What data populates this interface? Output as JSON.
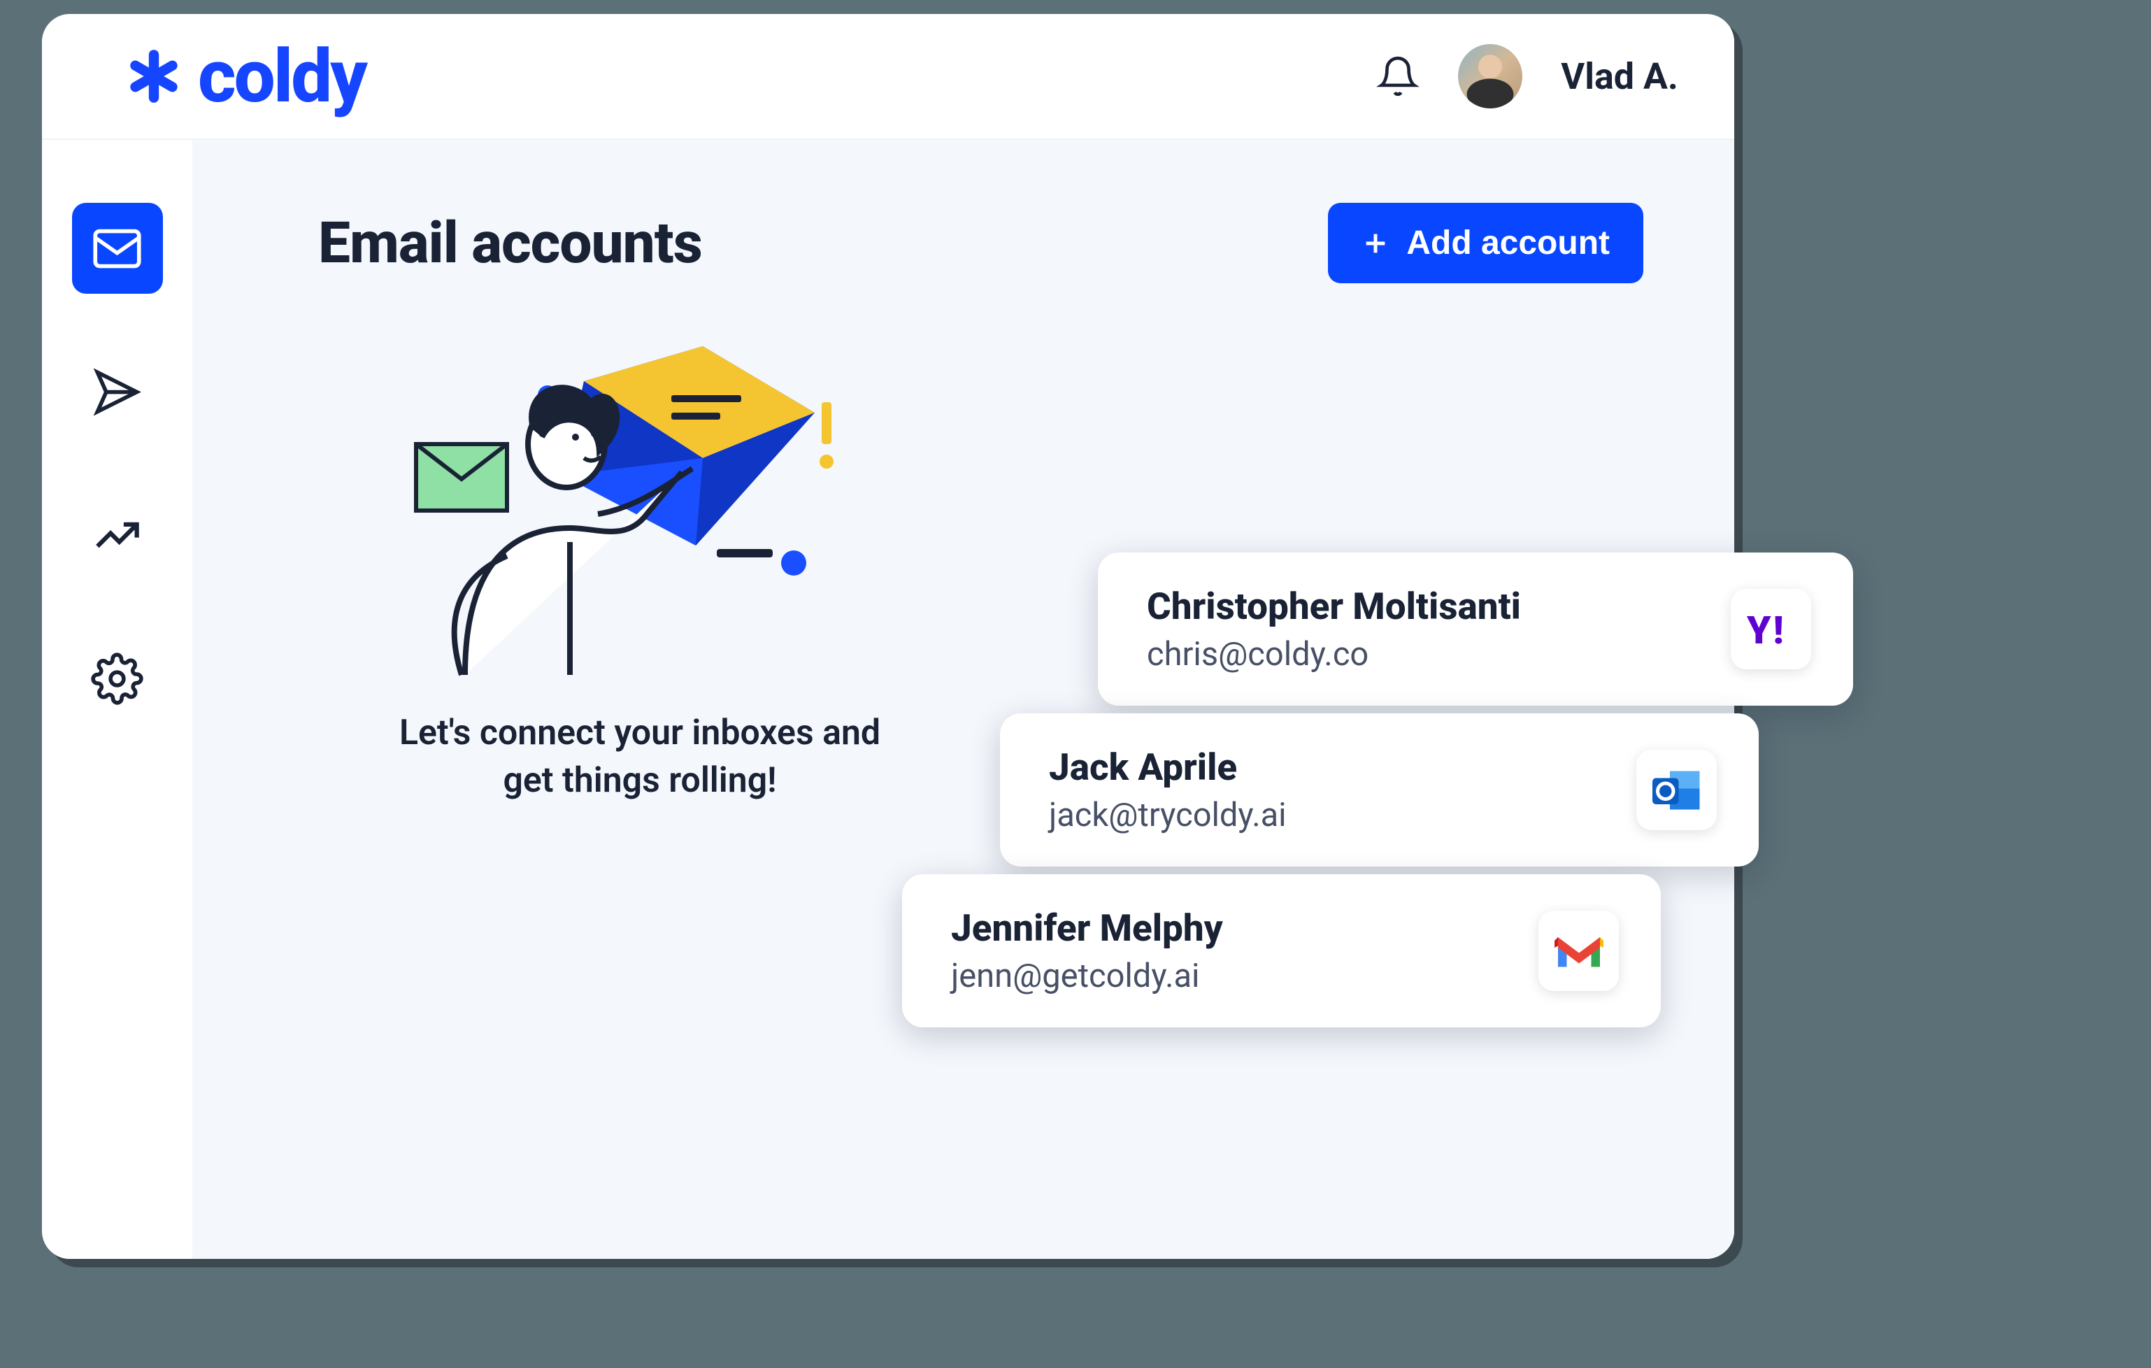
{
  "brand": {
    "name": "coldy"
  },
  "header": {
    "user_name": "Vlad A."
  },
  "sidebar": {
    "items": [
      {
        "id": "inbox",
        "icon": "mail-icon",
        "active": true
      },
      {
        "id": "send",
        "icon": "send-icon",
        "active": false
      },
      {
        "id": "analytics",
        "icon": "trending-icon",
        "active": false
      },
      {
        "id": "settings",
        "icon": "gear-icon",
        "active": false
      }
    ]
  },
  "main": {
    "title": "Email accounts",
    "add_button_label": "Add account",
    "empty_prompt_line1": "Let's connect your inboxes and",
    "empty_prompt_line2": "get things rolling!"
  },
  "accounts": [
    {
      "name": "Christopher Moltisanti",
      "email": "chris@coldy.co",
      "provider": "yahoo"
    },
    {
      "name": "Jack Aprile",
      "email": "jack@trycoldy.ai",
      "provider": "outlook"
    },
    {
      "name": "Jennifer Melphy",
      "email": "jenn@getcoldy.ai",
      "provider": "gmail"
    }
  ],
  "colors": {
    "primary": "#0847ff",
    "text": "#1a2235",
    "panel": "#f4f7fc"
  }
}
